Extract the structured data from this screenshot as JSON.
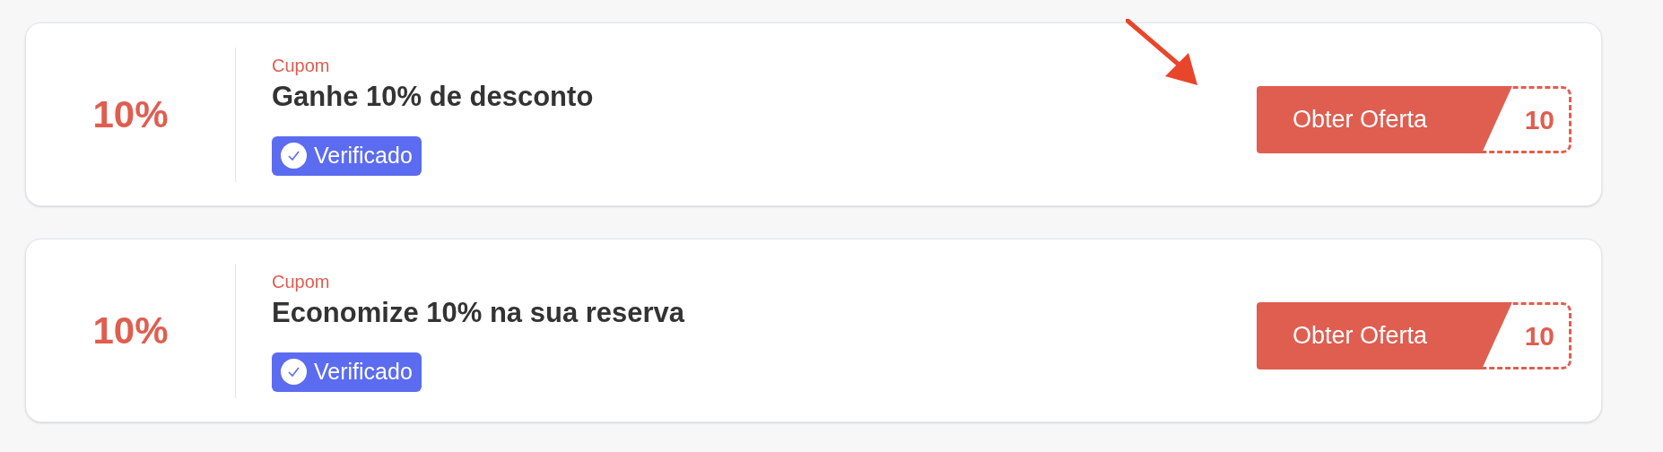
{
  "offers": [
    {
      "discount": "10%",
      "type": "Cupom",
      "title": "Ganhe 10% de desconto",
      "badge": {
        "label": "Verificado",
        "verified": true
      },
      "button": "Obter Oferta",
      "code_peek": "10",
      "annotated": true
    },
    {
      "discount": "10%",
      "type": "Cupom",
      "title": "Economize 10% na sua reserva",
      "badge": {
        "label": "Verificado",
        "verified": true
      },
      "button": "Obter Oferta",
      "code_peek": "10",
      "annotated": false
    }
  ]
}
